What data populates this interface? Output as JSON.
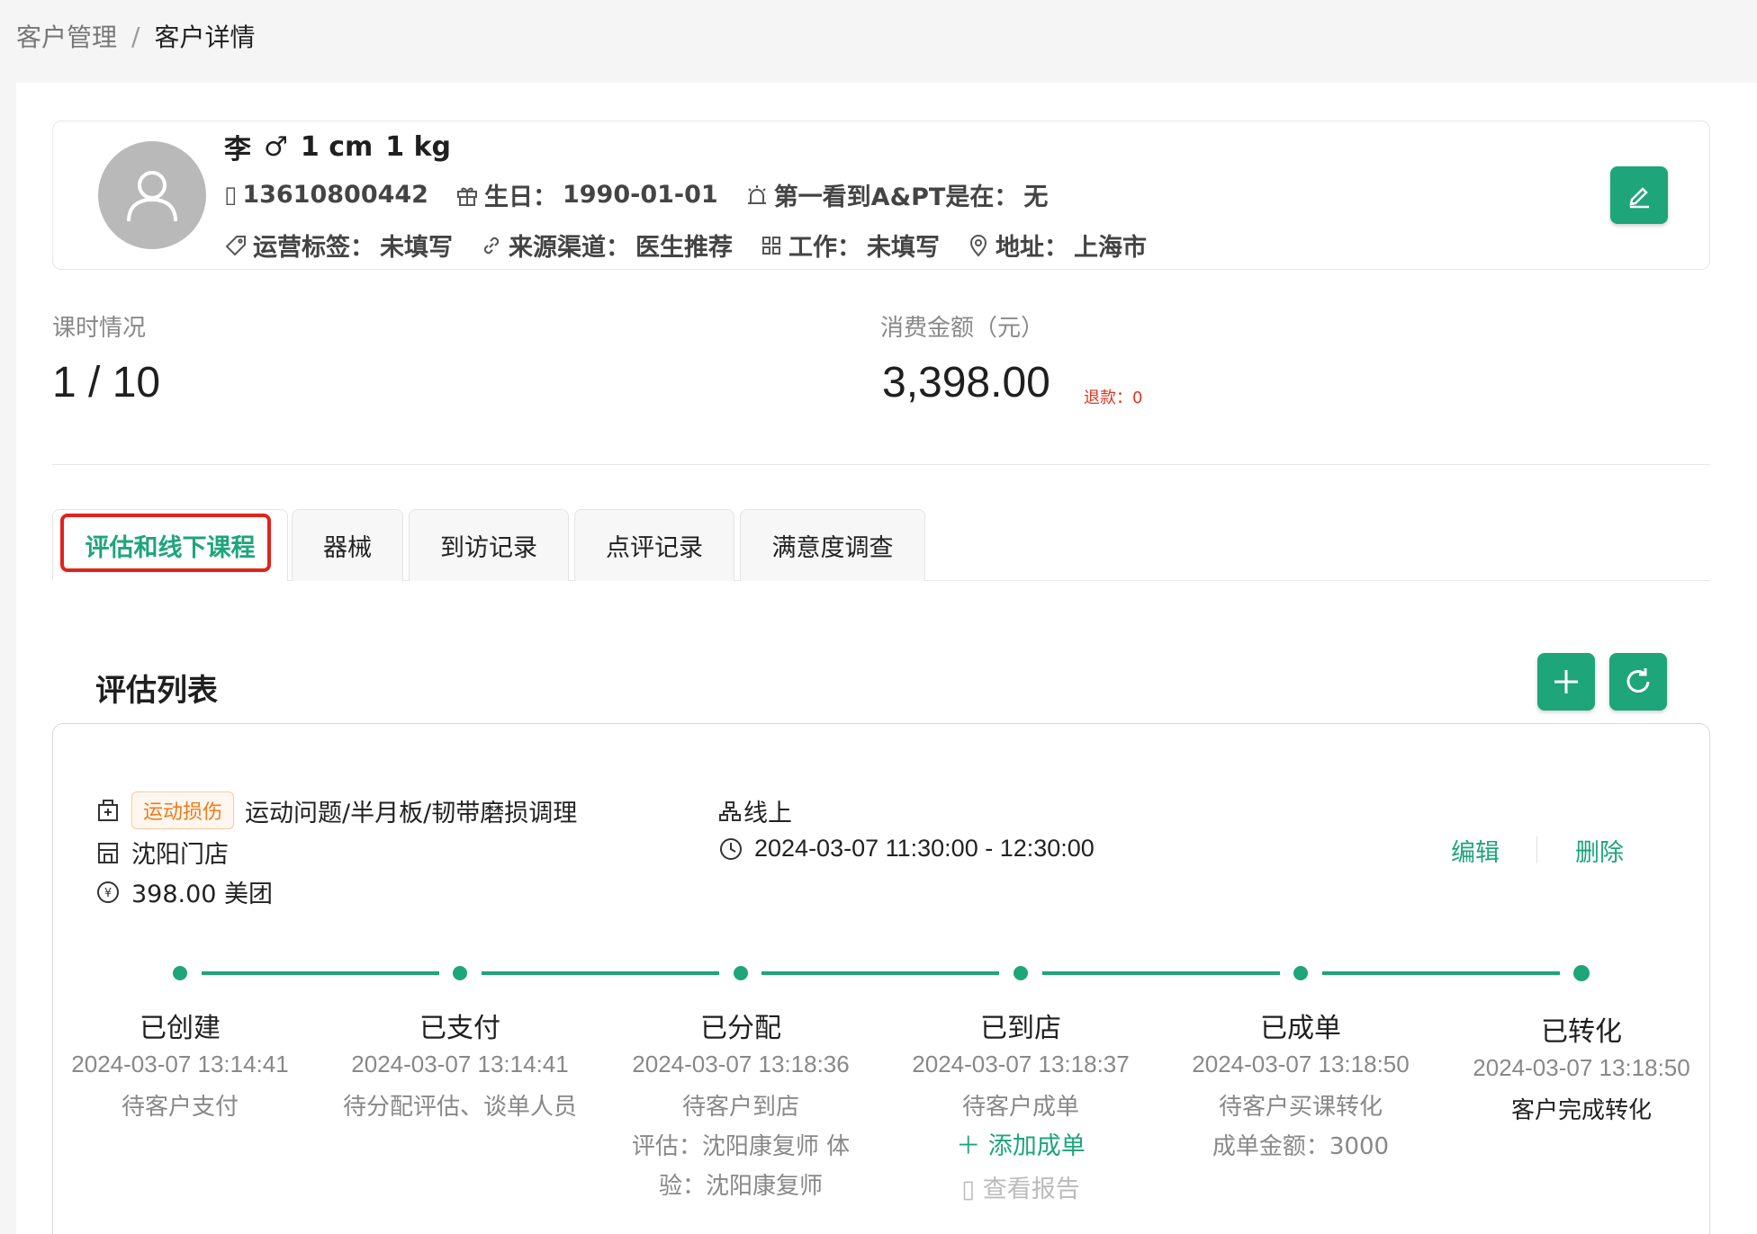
{
  "breadcrumb": {
    "parent": "客户管理",
    "separator": "/",
    "current": "客户详情"
  },
  "profile": {
    "name": "李",
    "gender_symbol": "♂",
    "height": "1 cm",
    "weight": "1 kg",
    "phone": "13610800442",
    "birthday_label": "生日：",
    "birthday": "1990-01-01",
    "first_seen_label": "第一看到A&PT是在：",
    "first_seen": "无",
    "ops_tag_label": "运营标签：",
    "ops_tag": "未填写",
    "source_label": "来源渠道：",
    "source": "医生推荐",
    "job_label": "工作：",
    "job": "未填写",
    "address_label": "地址：",
    "address": "上海市"
  },
  "stats": {
    "lessons_label": "课时情况",
    "lessons_value": "1 / 10",
    "spend_label": "消费金额（元）",
    "spend_value": "3,398.00",
    "refund": "退款：0"
  },
  "tabs": [
    {
      "label": "评估和线下课程",
      "active": true
    },
    {
      "label": "器械"
    },
    {
      "label": "到访记录"
    },
    {
      "label": "点评记录"
    },
    {
      "label": "满意度调查"
    }
  ],
  "eval": {
    "title": "评估列表",
    "tag": "运动损伤",
    "program": "运动问题/半月板/韧带磨损调理",
    "store": "沈阳门店",
    "price": "398.00 美团",
    "mode": "线上",
    "time": "2024-03-07 11:30:00 - 12:30:00",
    "edit_label": "编辑",
    "delete_label": "删除"
  },
  "timeline": [
    {
      "title": "已创建",
      "time": "2024-03-07 13:14:41",
      "desc": "待客户支付"
    },
    {
      "title": "已支付",
      "time": "2024-03-07 13:14:41",
      "desc": "待分配评估、谈单人员"
    },
    {
      "title": "已分配",
      "time": "2024-03-07 13:18:36",
      "desc": "待客户到店",
      "extra1": "评估：沈阳康复师 体",
      "extra2": "验：沈阳康复师"
    },
    {
      "title": "已到店",
      "time": "2024-03-07 13:18:37",
      "desc": "待客户成单",
      "add_deal": "添加成单",
      "view_report": "查看报告"
    },
    {
      "title": "已成单",
      "time": "2024-03-07 13:18:50",
      "desc": "待客户买课转化",
      "extra1": "成单金额：3000"
    },
    {
      "title": "已转化",
      "time": "2024-03-07 13:18:50",
      "desc": "客户完成转化"
    }
  ],
  "colors": {
    "accent": "#1ea57a",
    "highlight": "#e0241b",
    "refund": "#e0341f",
    "tag": "#f07a1a"
  }
}
